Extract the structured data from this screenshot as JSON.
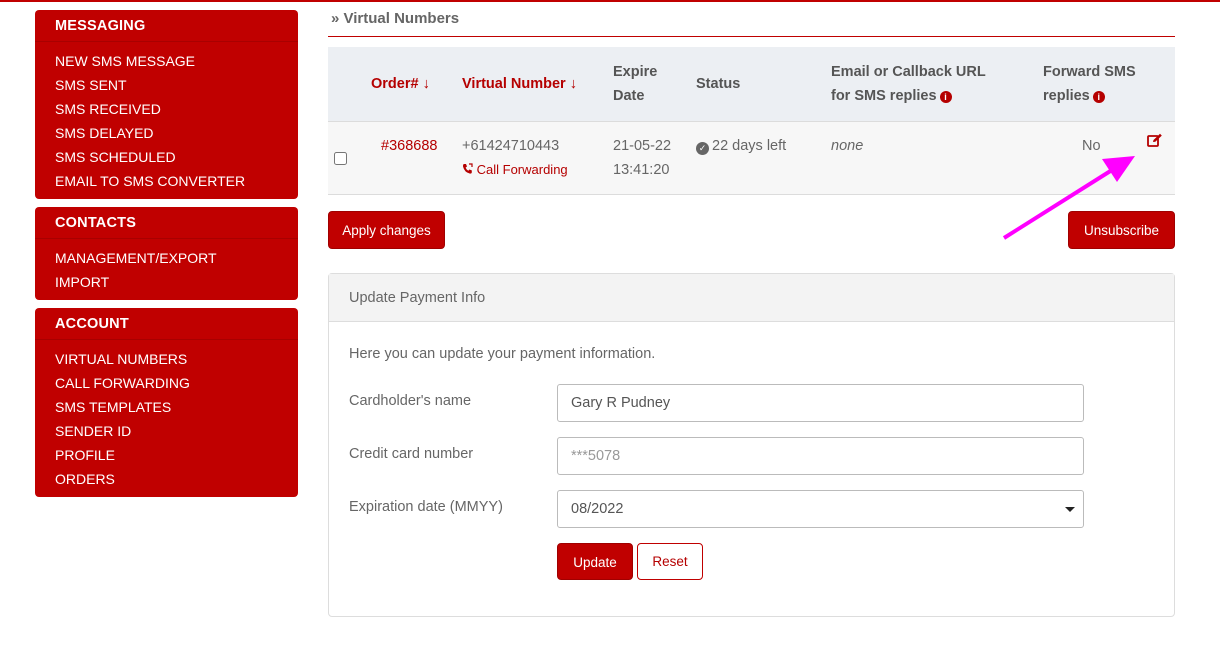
{
  "sidebar": {
    "messaging": {
      "title": "MESSAGING",
      "items": [
        "NEW SMS MESSAGE",
        "SMS SENT",
        "SMS RECEIVED",
        "SMS DELAYED",
        "SMS SCHEDULED",
        "EMAIL TO SMS CONVERTER"
      ]
    },
    "contacts": {
      "title": "CONTACTS",
      "items": [
        "MANAGEMENT/EXPORT",
        "IMPORT"
      ]
    },
    "account": {
      "title": "ACCOUNT",
      "items": [
        "VIRTUAL NUMBERS",
        "CALL FORWARDING",
        "SMS TEMPLATES",
        "SENDER ID",
        "PROFILE",
        "ORDERS"
      ]
    }
  },
  "breadcrumb": "» Virtual Numbers",
  "table": {
    "headers": {
      "order": "Order#",
      "virtual_number": "Virtual Number",
      "expire_1": "Expire",
      "expire_2": "Date",
      "status": "Status",
      "email_1": "Email or Callback URL",
      "email_2": "for SMS replies",
      "forward_1": "Forward SMS",
      "forward_2": "replies",
      "sort_arrow": "↓"
    },
    "row": {
      "order": "#368688",
      "number": "+61424710443",
      "call_forwarding": "Call Forwarding",
      "expire_date": "21-05-22",
      "expire_time": "13:41:20",
      "status": "22 days left",
      "callback": "none",
      "forward": "No"
    }
  },
  "buttons": {
    "apply": "Apply changes",
    "unsubscribe": "Unsubscribe",
    "update": "Update",
    "reset": "Reset"
  },
  "payment": {
    "title": "Update Payment Info",
    "intro": "Here you can update your payment information.",
    "name_label": "Cardholder's name",
    "name_value": "Gary R Pudney",
    "card_label": "Credit card number",
    "card_placeholder": "***5078",
    "exp_label": "Expiration date (MMYY)",
    "exp_value": "08/2022"
  },
  "colors": {
    "brand": "#c00000",
    "annotation_arrow": "#ff00ff"
  },
  "icons": {
    "edit": "edit-icon",
    "info": "info-icon",
    "check": "check-circle-icon",
    "phone": "phone-forward-icon"
  }
}
